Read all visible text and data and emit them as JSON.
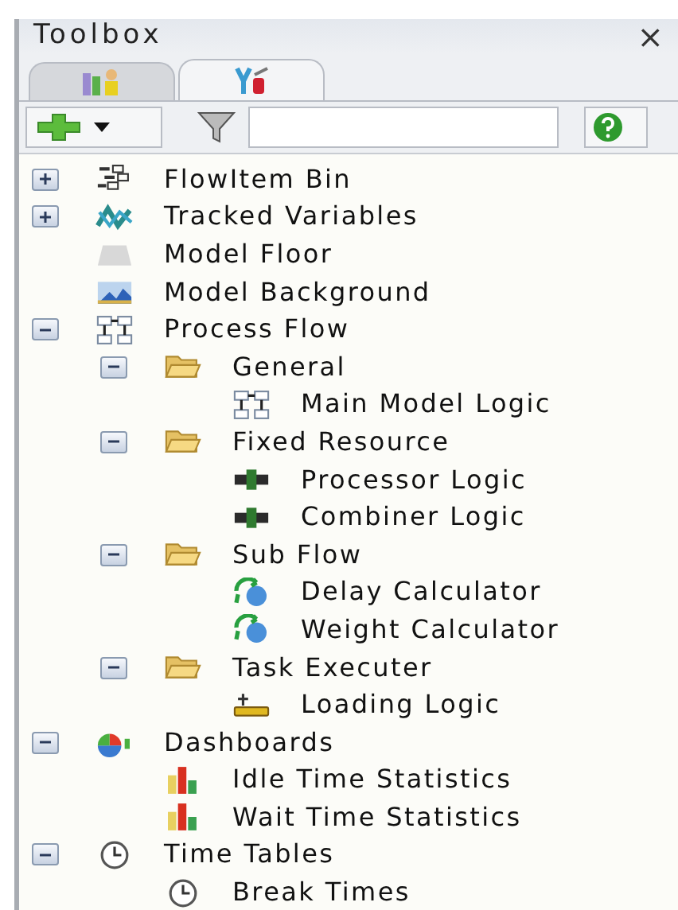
{
  "window": {
    "title": "Toolbox",
    "close": "×"
  },
  "tabs": [
    {
      "selected": false
    },
    {
      "selected": true
    }
  ],
  "tree": [
    {
      "label": "FlowItem Bin",
      "kind": "bin",
      "expanded": false
    },
    {
      "label": "Tracked Variables",
      "kind": "tracked",
      "expanded": false
    },
    {
      "label": "Model Floor",
      "kind": "floor"
    },
    {
      "label": "Model Background",
      "kind": "background"
    },
    {
      "label": "Process Flow",
      "kind": "flow",
      "expanded": true,
      "children": [
        {
          "label": "General",
          "kind": "folder",
          "expanded": true,
          "children": [
            {
              "label": "Main Model Logic",
              "kind": "flow"
            }
          ]
        },
        {
          "label": "Fixed Resource",
          "kind": "folder",
          "expanded": true,
          "children": [
            {
              "label": "Processor Logic",
              "kind": "resource"
            },
            {
              "label": "Combiner Logic",
              "kind": "resource"
            }
          ]
        },
        {
          "label": "Sub Flow",
          "kind": "folder",
          "expanded": true,
          "children": [
            {
              "label": "Delay Calculator",
              "kind": "subflow"
            },
            {
              "label": "Weight Calculator",
              "kind": "subflow"
            }
          ]
        },
        {
          "label": "Task Executer",
          "kind": "folder",
          "expanded": true,
          "children": [
            {
              "label": "Loading Logic",
              "kind": "loader"
            }
          ]
        }
      ]
    },
    {
      "label": "Dashboards",
      "kind": "dashboard",
      "expanded": true,
      "children": [
        {
          "label": "Idle Time Statistics",
          "kind": "barchart"
        },
        {
          "label": "Wait Time Statistics",
          "kind": "barchart"
        }
      ]
    },
    {
      "label": "Time Tables",
      "kind": "clock",
      "expanded": true,
      "children": [
        {
          "label": "Break Times",
          "kind": "clock"
        }
      ]
    }
  ]
}
